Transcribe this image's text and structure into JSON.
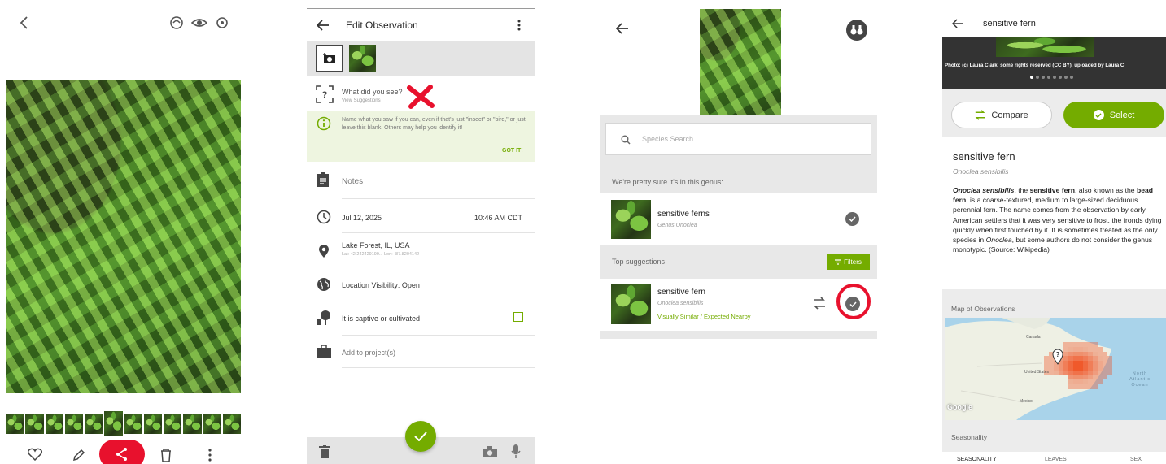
{
  "p1": {
    "thumb_count": 12
  },
  "p2": {
    "title": "Edit Observation",
    "what_label": "What did you see?",
    "view_suggestions": "View Suggestions",
    "tip_text": "Name what you saw if you can, even if that's just \"insect\" or \"bird,\" or just leave this blank. Others may help you identify it!",
    "got_it": "GOT IT!",
    "notes": "Notes",
    "date": "Jul 12, 2025",
    "time": "10:46 AM CDT",
    "place": "Lake Forest, IL, USA",
    "coords": "Lat: 42.242429199...  Lon: -87.8204142",
    "visibility": "Location Visibility: Open",
    "captive": "It is captive or cultivated",
    "projects": "Add to project(s)"
  },
  "p3": {
    "search_placeholder": "Species Search",
    "genus_heading": "We're pretty sure it's in this genus:",
    "genus_name": "sensitive ferns",
    "genus_sub": "Genus Onoclea",
    "top_heading": "Top suggestions",
    "filters": "Filters",
    "sugg_name": "sensitive fern",
    "sugg_sci": "Onoclea sensibilis",
    "sugg_reason": "Visually Similar / Expected Nearby"
  },
  "p4": {
    "title": "sensitive fern",
    "photo_credit": "Photo: (c) Laura Clark, some rights reserved (CC BY), uploaded by Laura C",
    "compare": "Compare",
    "select": "Select",
    "common_name": "sensitive fern",
    "sci_name": "Onoclea sensibilis",
    "desc_sci": "Onoclea sensibilis",
    "desc_1": ", the ",
    "desc_bold1": "sensitive fern",
    "desc_2": ", also known as the ",
    "desc_bold2": "bead fern",
    "desc_3": ", is a coarse-textured, medium to large-sized deciduous perennial fern. The name comes from the observation by early American settlers that it was very sensitive to frost, the fronds dying quickly when first touched by it. It is sometimes treated as the only species in ",
    "desc_genus": "Onoclea",
    "desc_4": ", but some authors do not consider the genus monotypic. (Source: Wikipedia)",
    "map_heading": "Map of Observations",
    "map_canada": "Canada",
    "map_us": "United States",
    "map_mexico": "Mexico",
    "map_ocean": "North Atlantic Ocean",
    "map_logo": "Google",
    "seasonality_heading": "Seasonality",
    "tabs": [
      "SEASONALITY",
      "LEAVES",
      "SEX"
    ]
  },
  "colors": {
    "inat_green": "#74ac00",
    "tip_bg": "#eef5e0",
    "annotation_red": "#e8112d"
  }
}
